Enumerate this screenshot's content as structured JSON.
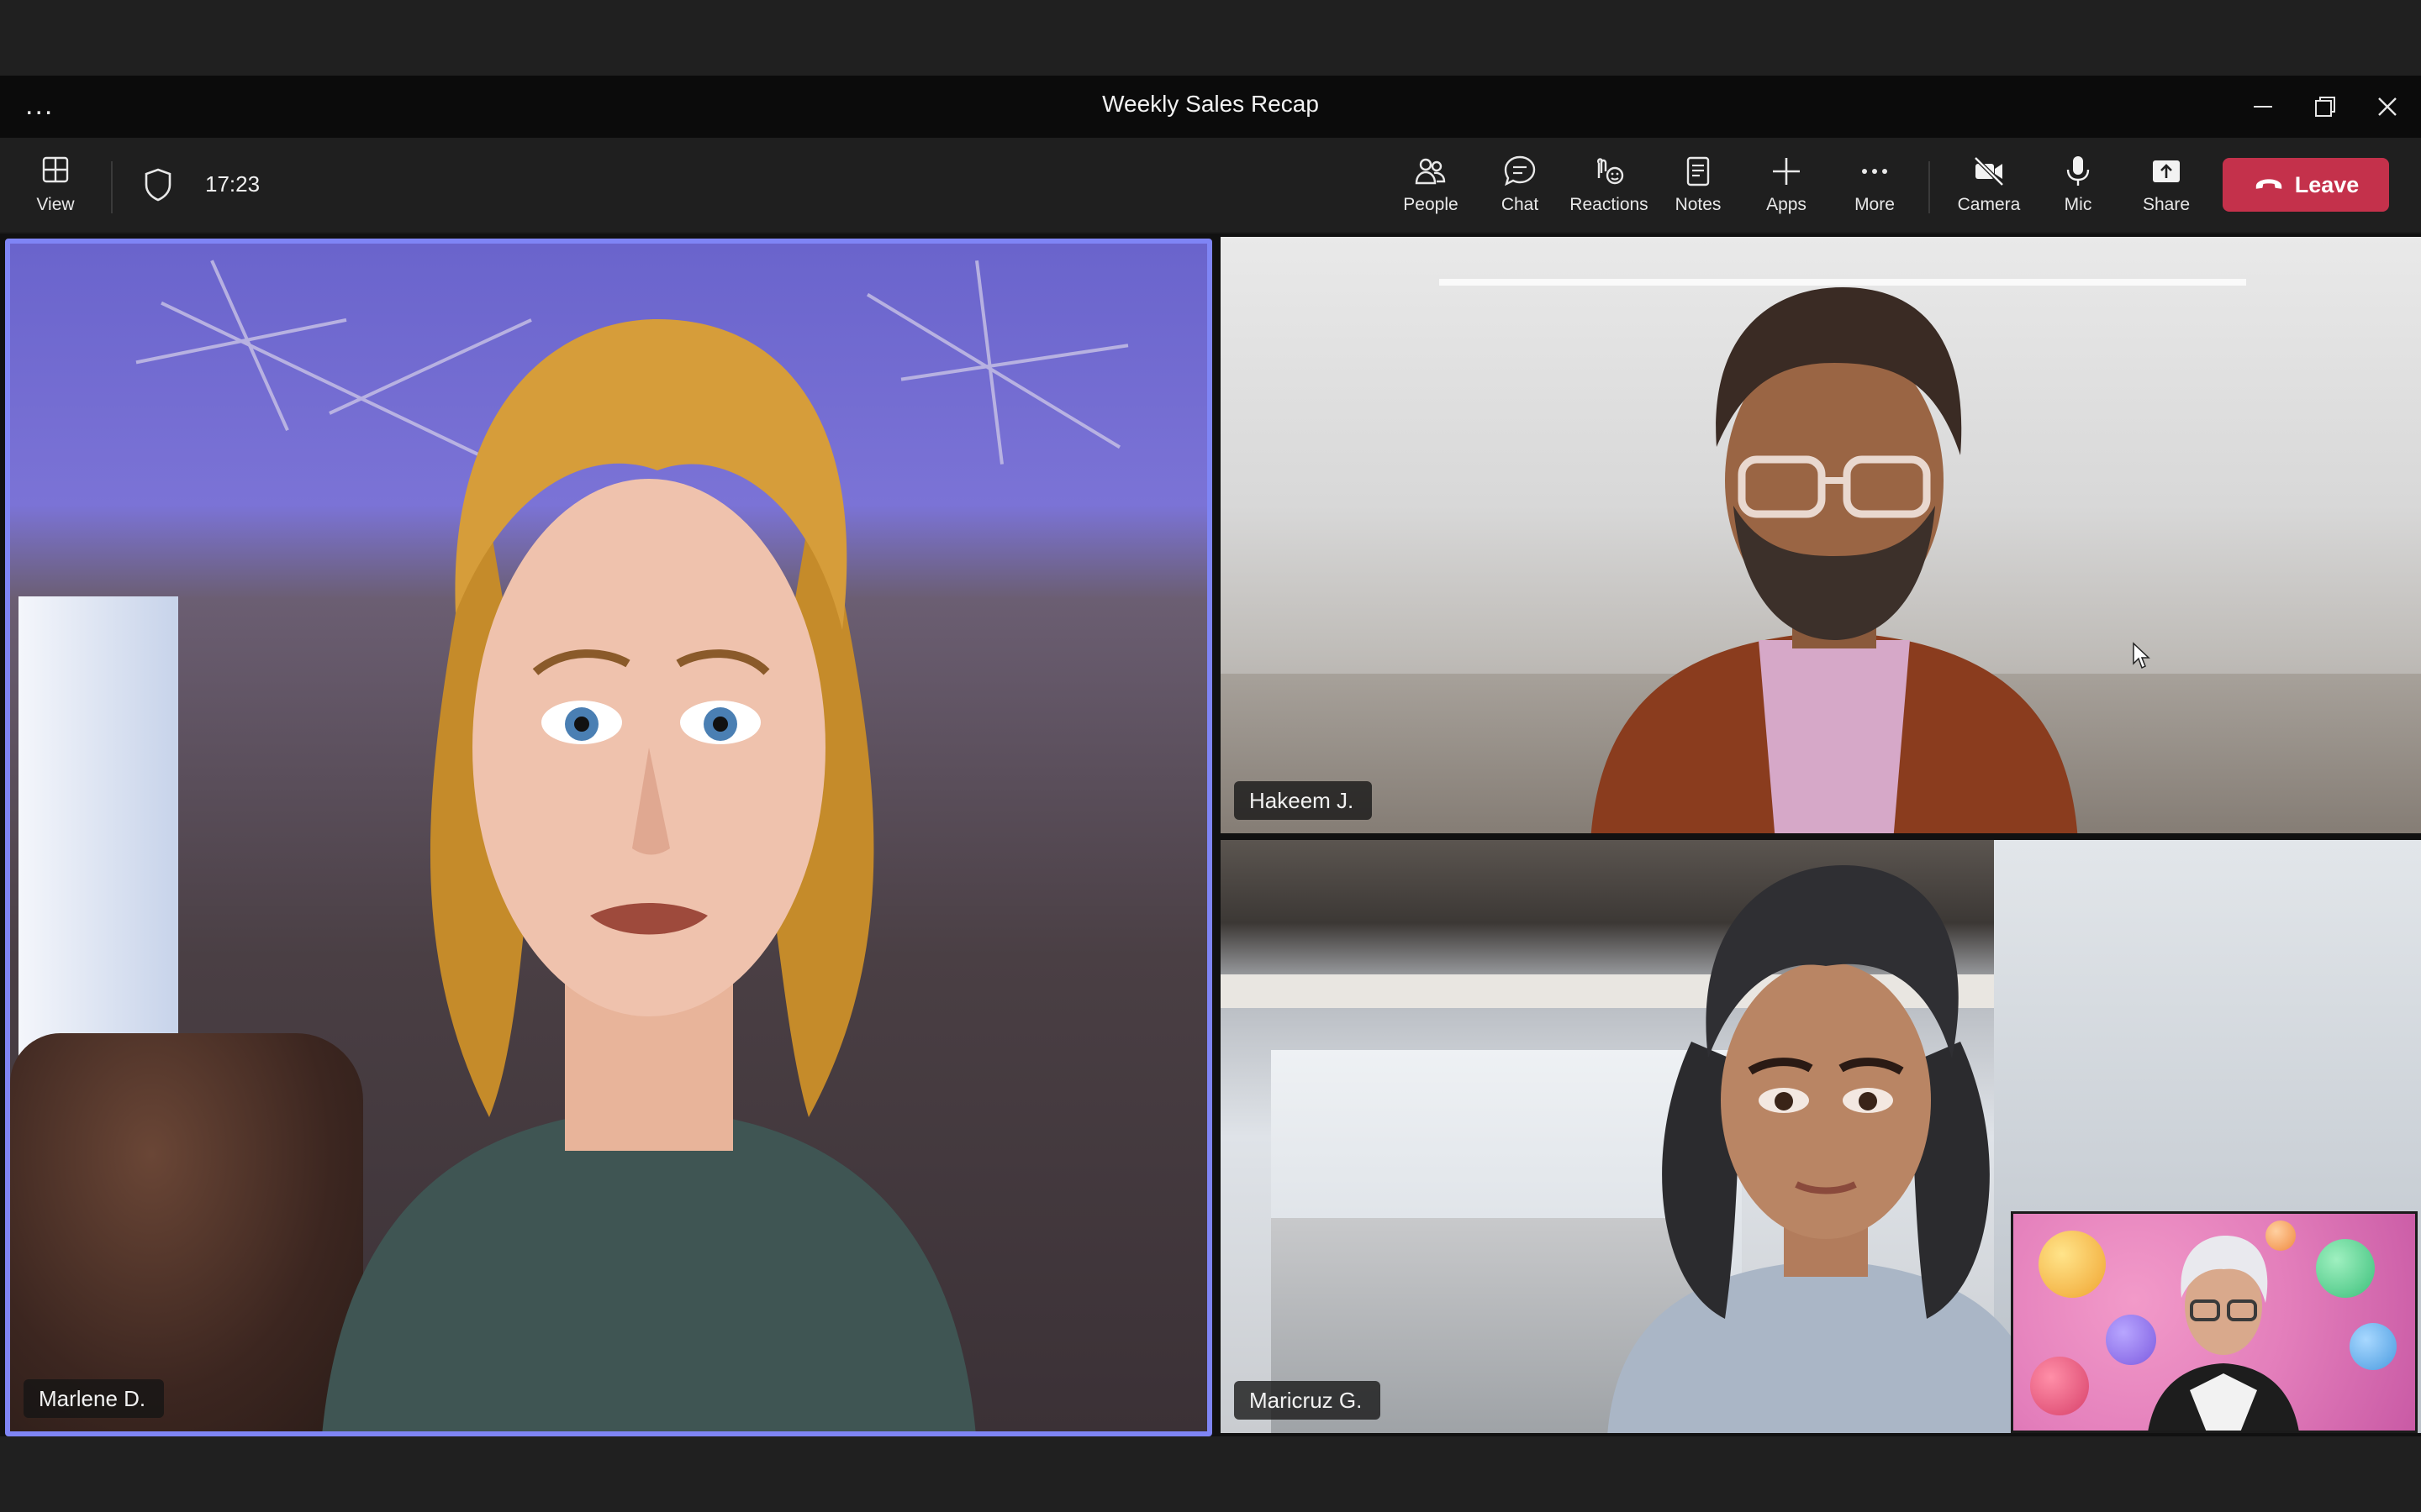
{
  "window": {
    "title": "Weekly Sales Recap",
    "more_label": "..."
  },
  "toolbar": {
    "view_label": "View",
    "timer": "17:23",
    "people_label": "People",
    "chat_label": "Chat",
    "reactions_label": "Reactions",
    "notes_label": "Notes",
    "apps_label": "Apps",
    "more_label": "More",
    "camera_label": "Camera",
    "mic_label": "Mic",
    "share_label": "Share",
    "leave_label": "Leave"
  },
  "participants": [
    {
      "name": "Marlene D."
    },
    {
      "name": "Hakeem J."
    },
    {
      "name": "Maricruz G."
    }
  ],
  "colors": {
    "accent": "#7f85f5",
    "leave": "#c4314b",
    "toolbar_bg": "#1f1f1f",
    "titlebar_bg": "#0b0b0b"
  }
}
